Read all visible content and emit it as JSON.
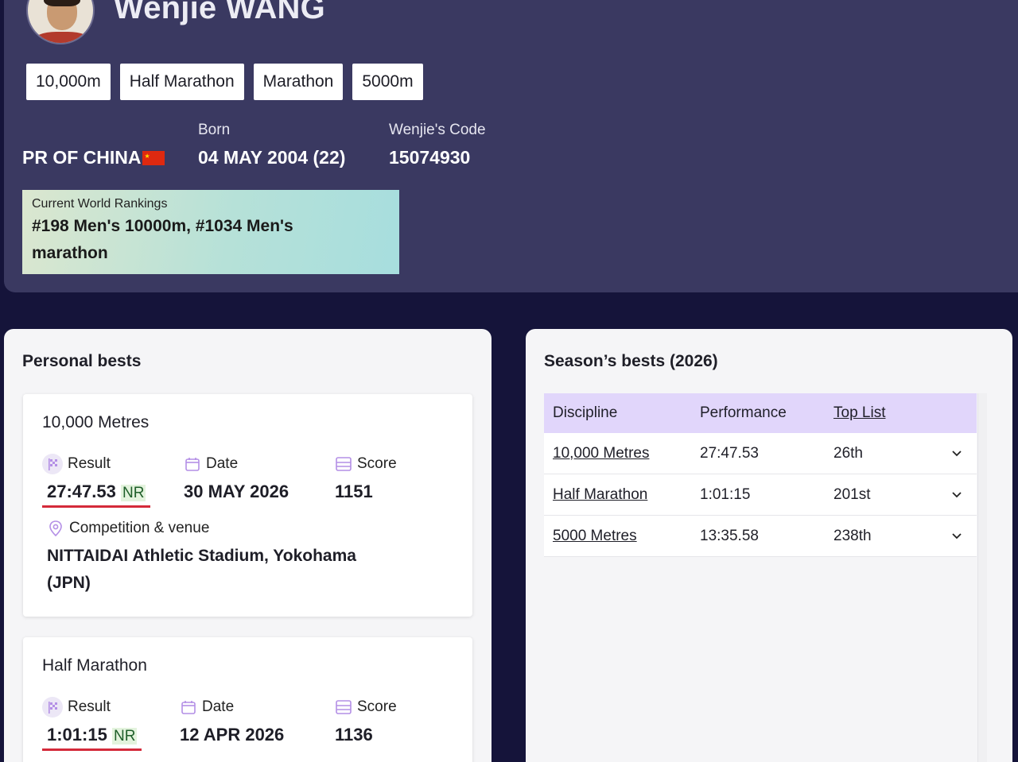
{
  "athlete": {
    "name": "Wenjie WANG",
    "country": "PR OF CHINA",
    "born_label": "Born",
    "born_value": "04 MAY 2004 (22)",
    "code_label": "Wenjie's Code",
    "code_value": "15074930"
  },
  "discipline_tabs": [
    "10,000m",
    "Half Marathon",
    "Marathon",
    "5000m"
  ],
  "rankings": {
    "label": "Current World Rankings",
    "value": "#198 Men's 10000m, #1034 Men's marathon"
  },
  "personal_bests": {
    "title": "Personal bests",
    "result_label": "Result",
    "date_label": "Date",
    "score_label": "Score",
    "venue_label": "Competition & venue",
    "cards": [
      {
        "discipline": "10,000 Metres",
        "result": "27:47.53",
        "record": "NR",
        "date": "30 MAY 2026",
        "score": "1151",
        "venue": "NITTAIDAI Athletic Stadium, Yokohama (JPN)"
      },
      {
        "discipline": "Half Marathon",
        "result": "1:01:15",
        "record": "NR",
        "date": "12 APR 2026",
        "score": "1136"
      }
    ]
  },
  "season_bests": {
    "title": "Season’s bests (2026)",
    "headers": [
      "Discipline",
      "Performance",
      "Top List"
    ],
    "rows": [
      {
        "discipline": "10,000 Metres",
        "performance": "27:47.53",
        "top_list": "26th"
      },
      {
        "discipline": "Half Marathon",
        "performance": "1:01:15",
        "top_list": "201st"
      },
      {
        "discipline": "5000 Metres",
        "performance": "13:35.58",
        "top_list": "238th"
      }
    ]
  },
  "colors": {
    "page_bg": "#15143a",
    "header_bg": "#3a3961",
    "table_header_bg": "#e1d6fb",
    "result_underline": "#d42a3a",
    "icon_purple": "#b48fe6"
  }
}
